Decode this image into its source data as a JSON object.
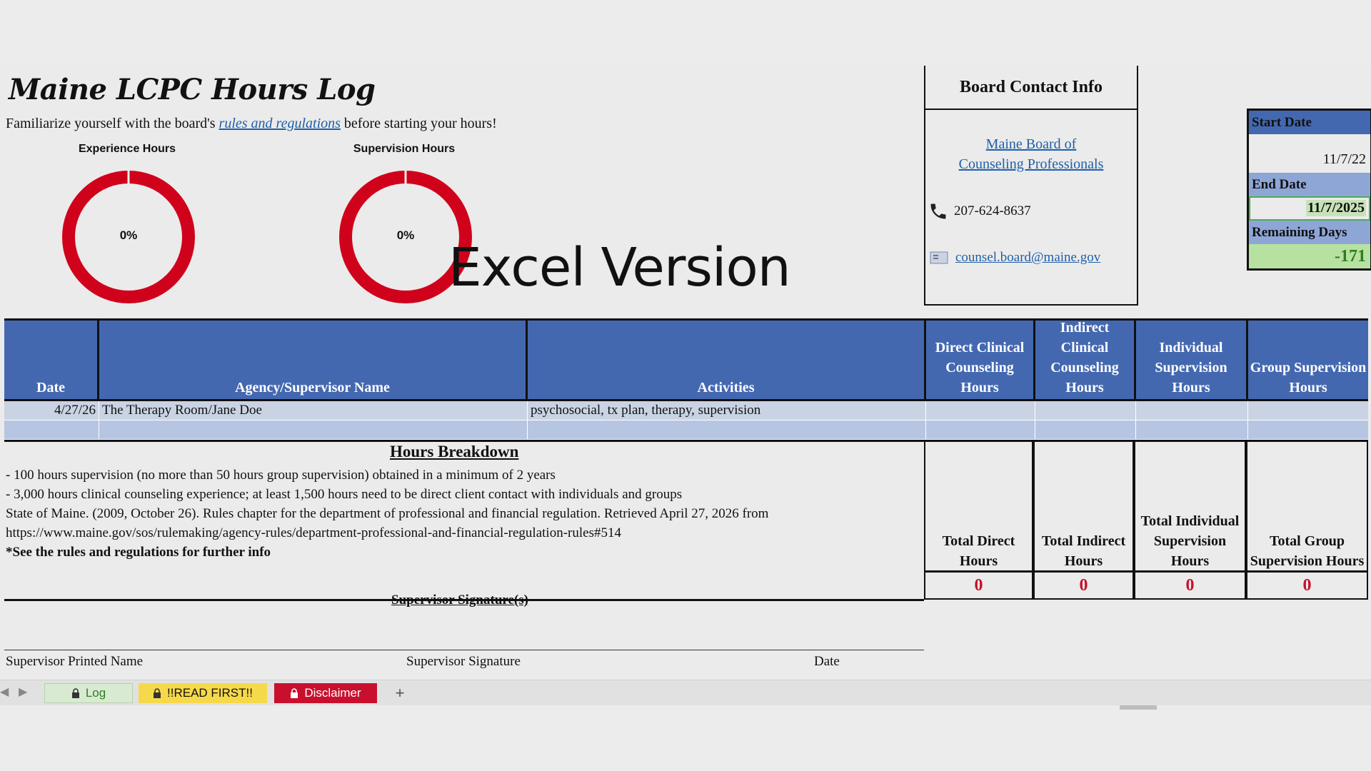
{
  "title": "Maine LCPC Hours Log",
  "intro": {
    "before": "Familiarize yourself with the board's ",
    "link": "rules and regulations",
    "after": " before starting your hours!"
  },
  "gauges": [
    {
      "label": "Experience Hours",
      "percent_text": "0%",
      "progress": 0
    },
    {
      "label": "Supervision Hours",
      "percent_text": "0%",
      "progress": 0
    }
  ],
  "overlay_text": "Excel Version",
  "contact": {
    "header": "Board Contact Info",
    "board_link_line1": "Maine Board of",
    "board_link_line2": "Counseling Professionals",
    "phone": "207-624-8637",
    "email": "counsel.board@maine.gov"
  },
  "dates": {
    "start_label": "Start Date",
    "start_value": "11/7/22",
    "end_label": "End Date",
    "end_value": "11/7/2025",
    "remaining_label": "Remaining Days",
    "remaining_value": "-171"
  },
  "table": {
    "headers": {
      "date": "Date",
      "agency": "Agency/Supervisor Name",
      "activities": "Activities",
      "direct": "Direct Clinical Counseling Hours",
      "indirect": "Indirect Clinical Counseling Hours",
      "individual": "Individual Supervision Hours",
      "group": "Group Supervision Hours"
    },
    "rows": [
      {
        "date": "4/27/26",
        "agency": "The Therapy Room/Jane Doe",
        "activities": "psychosocial, tx plan, therapy, supervision",
        "direct": "",
        "indirect": "",
        "individual": "",
        "group": ""
      },
      {
        "date": "",
        "agency": "",
        "activities": "",
        "direct": "",
        "indirect": "",
        "individual": "",
        "group": ""
      }
    ]
  },
  "breakdown": {
    "heading": "Hours Breakdown",
    "line1": "- 100 hours supervision (no more than 50 hours group supervision) obtained in a minimum of 2 years",
    "line2": "- 3,000 hours clinical counseling experience; at least 1,500 hours need to be direct client contact with individuals and groups",
    "line3": "State of Maine. (2009, October 26). Rules chapter for the department of professional and financial regulation. Retrieved April 27, 2026 from",
    "line4": "https://www.maine.gov/sos/rulemaking/agency-rules/department-professional-and-financial-regulation-rules#514",
    "line5": "*See the rules and regulations for further info"
  },
  "totals": [
    {
      "label": "Total Direct Hours",
      "value": "0"
    },
    {
      "label": "Total Indirect Hours",
      "value": "0"
    },
    {
      "label": "Total Individual Supervision Hours",
      "value": "0"
    },
    {
      "label": "Total Group Supervision Hours",
      "value": "0"
    }
  ],
  "signature": {
    "heading": "Supervisor Signature(s)",
    "printed_name": "Supervisor Printed Name",
    "signature": "Supervisor Signature",
    "date": "Date"
  },
  "tabs": [
    {
      "label": "Log",
      "icon": "lock-icon",
      "color": "#d9ead3"
    },
    {
      "label": "!!READ FIRST!!",
      "icon": "lock-icon",
      "color": "#f6d94a"
    },
    {
      "label": "Disclaimer",
      "icon": "lock-icon",
      "color": "#c8102e"
    }
  ],
  "add_sheet": "+",
  "colors": {
    "header_blue": "#4468b0",
    "gauge_red": "#d0021b",
    "remaining_green": "#b7e1a1",
    "total_red": "#c8102e"
  }
}
